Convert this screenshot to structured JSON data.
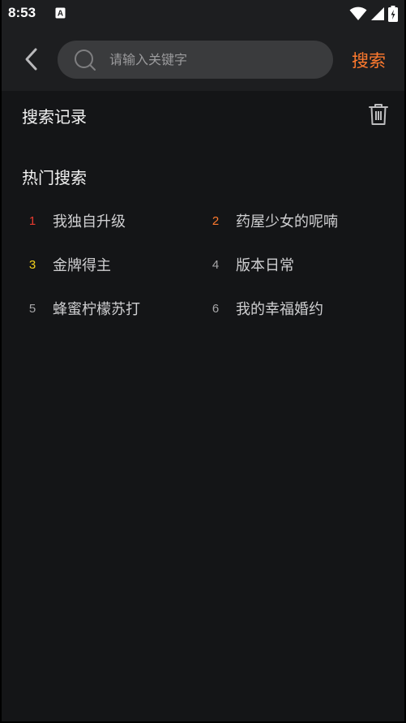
{
  "status_bar": {
    "time": "8:53",
    "notification_icon": "font-a-icon",
    "icons": [
      "wifi-icon",
      "signal-icon",
      "battery-charging-icon"
    ]
  },
  "header": {
    "back_icon": "chevron-left-icon",
    "search": {
      "placeholder": "请输入关键字",
      "value": ""
    },
    "search_label": "搜索"
  },
  "history": {
    "title": "搜索记录",
    "clear_icon": "trash-icon"
  },
  "hot": {
    "title": "热门搜索",
    "items": [
      {
        "rank": "1",
        "name": "我独自升级",
        "color": "#e83a2e"
      },
      {
        "rank": "2",
        "name": "药屋少女的呢喃",
        "color": "#ff7a2e"
      },
      {
        "rank": "3",
        "name": "金牌得主",
        "color": "#f5d21c"
      },
      {
        "rank": "4",
        "name": "版本日常",
        "color": "#a6a6a8"
      },
      {
        "rank": "5",
        "name": "蜂蜜柠檬苏打",
        "color": "#a6a6a8"
      },
      {
        "rank": "6",
        "name": "我的幸福婚约",
        "color": "#a6a6a8"
      }
    ]
  },
  "colors": {
    "accent": "#ff7a2e",
    "background": "#141517",
    "header": "#1d1e20",
    "search_box": "#3a3b3d"
  }
}
